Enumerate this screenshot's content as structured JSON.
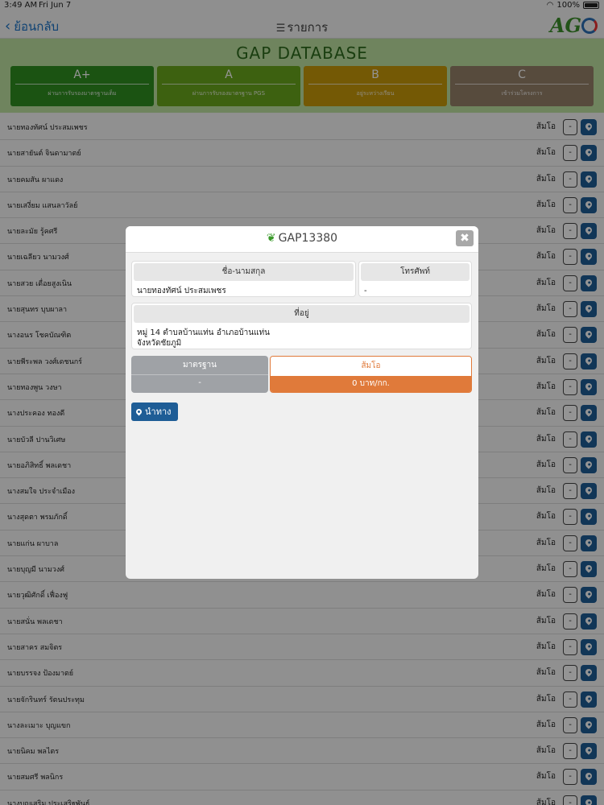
{
  "status_bar": {
    "time": "3:49 AM",
    "date": "Fri Jun 7",
    "battery": "100%"
  },
  "nav": {
    "back_label": "ย้อนกลับ",
    "title": "รายการ",
    "logo": "AG"
  },
  "banner": {
    "title": "GAP DATABASE",
    "grades": [
      {
        "label": "A+",
        "desc": "ผ่านการรับรองมาตรฐานเต็ม",
        "color": "#2f8f1f"
      },
      {
        "label": "A",
        "desc": "ผ่านการรับรองมาตรฐาน PGS",
        "color": "#6aa81d"
      },
      {
        "label": "B",
        "desc": "อยู่ระหว่างเรียน",
        "color": "#c99a0a"
      },
      {
        "label": "C",
        "desc": "เข้าร่วมโครงการ",
        "color": "#96826a"
      }
    ]
  },
  "list": {
    "items": [
      {
        "name": "นายทองทัศน์ ประสมเพชร",
        "price": "ส้มโอ"
      },
      {
        "name": "นายสายันต์ จินดามาตย์",
        "price": "ส้มโอ"
      },
      {
        "name": "นายคมสัน ผาแดง",
        "price": "ส้มโอ"
      },
      {
        "name": "นายเสงี่ยม แสนลาวัลย์",
        "price": "ส้มโอ"
      },
      {
        "name": "นายละมัย รู้คศรี",
        "price": "ส้มโอ"
      },
      {
        "name": "นายเฉลียว นามวงศ์",
        "price": "ส้มโอ"
      },
      {
        "name": "นายสวย เดื่อยสูงเนิน",
        "price": "ส้มโอ"
      },
      {
        "name": "นายสุนทร บุบผาลา",
        "price": "ส้มโอ"
      },
      {
        "name": "นางอนร โชคบัณฑิต",
        "price": "ส้มโอ"
      },
      {
        "name": "นายพีระพล วงศ์เดชนกร์",
        "price": "ส้มโอ"
      },
      {
        "name": "นายทองพูน วงษา",
        "price": "ส้มโอ"
      },
      {
        "name": "นางประคอง ทองดี",
        "price": "ส้มโอ"
      },
      {
        "name": "นายบัวลี ปานวิเศษ",
        "price": "ส้มโอ"
      },
      {
        "name": "นายอภิสิทธิ์ พลเดชา",
        "price": "ส้มโอ"
      },
      {
        "name": "นางสมใจ ประจำเมือง",
        "price": "ส้มโอ"
      },
      {
        "name": "นางสุดตา พรมภักดิ์",
        "price": "ส้มโอ"
      },
      {
        "name": "นายแก่น ผาบาล",
        "price": "ส้มโอ"
      },
      {
        "name": "นายบุญมี นามวงศ์",
        "price": "ส้มโอ"
      },
      {
        "name": "นายวุฒิศักดิ์ เฟื่องฟู",
        "price": "ส้มโอ"
      },
      {
        "name": "นายสนั่น พลเดชา",
        "price": "ส้มโอ"
      },
      {
        "name": "นายสาคร สมจิตร",
        "price": "ส้มโอ"
      },
      {
        "name": "นายบรรจง ป้องมาตย์",
        "price": "ส้มโอ"
      },
      {
        "name": "นายจักรินทร์ รัตนประทุม",
        "price": "ส้มโอ"
      },
      {
        "name": "นางละเมาะ บุญแขก",
        "price": "ส้มโอ"
      },
      {
        "name": "นายนิคม พลไตร",
        "price": "ส้มโอ"
      },
      {
        "name": "นายสมศรี พลนิกร",
        "price": "ส้มโอ"
      },
      {
        "name": "นางบุญเสริม ประเสริฐพันธุ์",
        "price": "ส้มโอ"
      }
    ],
    "minus_label": "-"
  },
  "modal": {
    "title": "GAP13380",
    "close_label": "✖",
    "name_header": "ชื่อ-นามสกุล",
    "name_value": "นายทองทัศน์ ประสมเพชร",
    "phone_header": "โทรศัพท์",
    "phone_value": "-",
    "address_header": "ที่อยู่",
    "address_line1": "หมู่ 14 ตำบลบ้านแท่น อำเภอบ้านแท่น",
    "address_line2": "จังหวัดชัยภูมิ",
    "standard_header": "มาตรฐาน",
    "standard_value": "-",
    "product_header": "ส้มโอ",
    "product_price": "0 บาท/กก.",
    "navigate_label": "นำทาง"
  }
}
